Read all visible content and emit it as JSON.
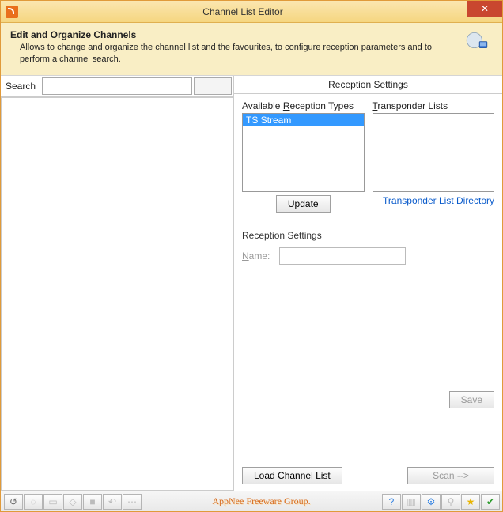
{
  "window": {
    "title": "Channel List Editor"
  },
  "info": {
    "heading": "Edit and Organize Channels",
    "description": "Allows to change and organize the channel list and the favourites, to configure reception parameters and to perform a channel search."
  },
  "search": {
    "label": "Search",
    "value": "",
    "placeholder": ""
  },
  "rs": {
    "header": "Reception Settings",
    "available_label_pre": "Available ",
    "available_label_ul": "R",
    "available_label_post": "eception Types",
    "transponder_label_ul": "T",
    "transponder_label_post": "ransponder Lists",
    "types": [
      "TS Stream"
    ],
    "transponders": [],
    "update_label": "Update",
    "directory_link": "Transponder List Directory",
    "group_label": "Reception Settings",
    "name_label_ul": "N",
    "name_label_post": "ame:",
    "name_value": "",
    "save_label": "Save",
    "load_label": "Load Channel List",
    "scan_label": "Scan -->"
  },
  "status": {
    "center": "AppNee Freeware Group."
  }
}
